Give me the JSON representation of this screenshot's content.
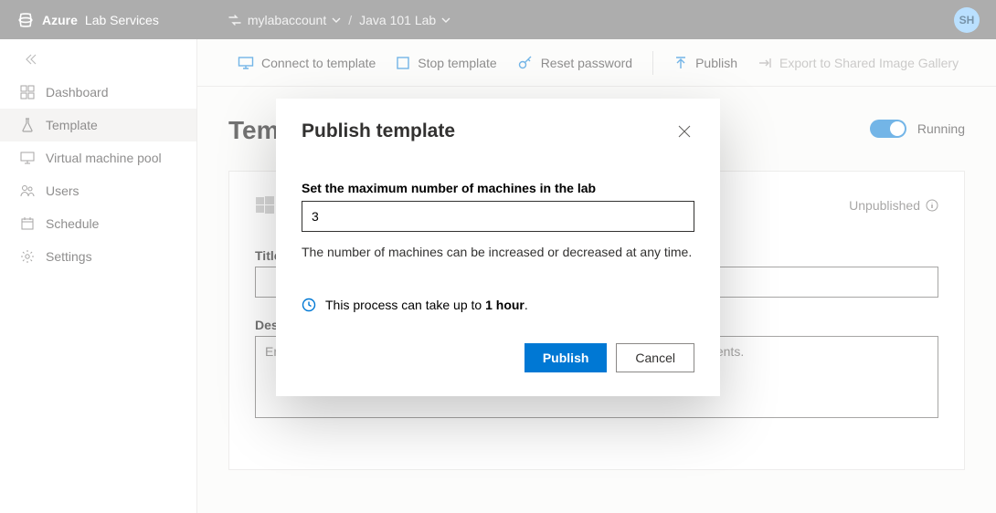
{
  "header": {
    "brand_strong": "Azure",
    "brand_light": "Lab Services",
    "breadcrumb_account": "mylabaccount",
    "breadcrumb_lab": "Java 101 Lab",
    "avatar_initials": "SH"
  },
  "sidebar": {
    "items": [
      {
        "icon": "dashboard",
        "label": "Dashboard"
      },
      {
        "icon": "template",
        "label": "Template"
      },
      {
        "icon": "vmpool",
        "label": "Virtual machine pool"
      },
      {
        "icon": "users",
        "label": "Users"
      },
      {
        "icon": "schedule",
        "label": "Schedule"
      },
      {
        "icon": "settings",
        "label": "Settings"
      }
    ]
  },
  "actionbar": {
    "connect": "Connect to template",
    "stop": "Stop template",
    "reset": "Reset password",
    "publish": "Publish",
    "export": "Export to Shared Image Gallery"
  },
  "page": {
    "title": "Template",
    "running_label": "Running",
    "unpublished_label": "Unpublished",
    "title_field_label": "Title",
    "desc_field_label": "Description",
    "desc_placeholder": "Enter a description for your class. This title and description will be visible to students."
  },
  "modal": {
    "title": "Publish template",
    "field_label": "Set the maximum number of machines in the lab",
    "machine_count": "3",
    "hint": "The number of machines can be increased or decreased at any time.",
    "note_prefix": "This process can take up to ",
    "note_bold": "1 hour",
    "note_suffix": ".",
    "publish_btn": "Publish",
    "cancel_btn": "Cancel"
  }
}
